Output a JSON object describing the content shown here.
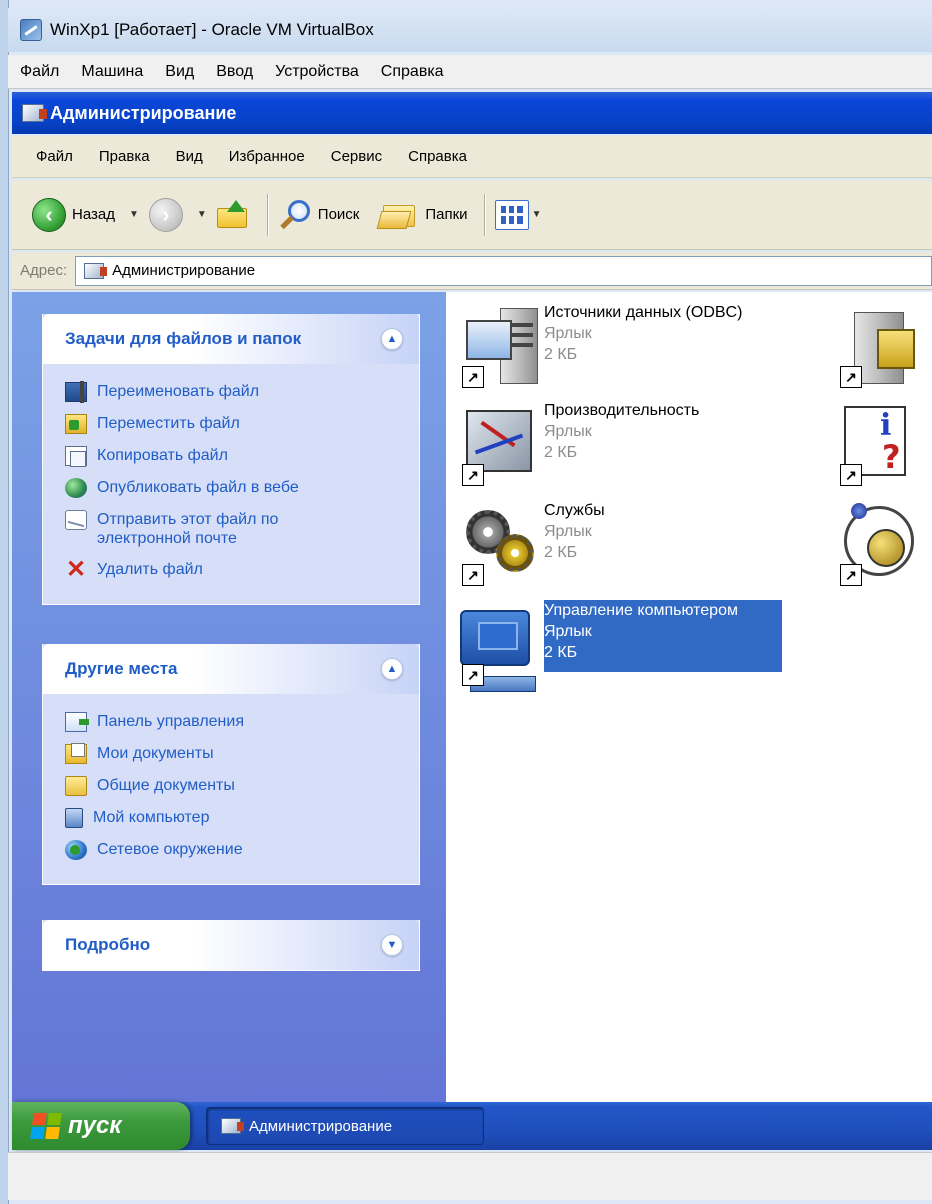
{
  "vbox": {
    "title": "WinXp1 [Работает] - Oracle VM VirtualBox",
    "menu": [
      "Файл",
      "Машина",
      "Вид",
      "Ввод",
      "Устройства",
      "Справка"
    ]
  },
  "explorer": {
    "title": "Администрирование",
    "menu": [
      "Файл",
      "Правка",
      "Вид",
      "Избранное",
      "Сервис",
      "Справка"
    ],
    "toolbar": {
      "back_label": "Назад",
      "search_label": "Поиск",
      "folders_label": "Папки"
    },
    "address": {
      "label": "Адрес:",
      "value": "Администрирование"
    }
  },
  "tasks_panel": {
    "title": "Задачи для файлов и папок",
    "items": [
      {
        "label": "Переименовать файл",
        "icon": "rename-icon"
      },
      {
        "label": "Переместить файл",
        "icon": "move-icon"
      },
      {
        "label": "Копировать файл",
        "icon": "copy-icon"
      },
      {
        "label": "Опубликовать файл в вебе",
        "icon": "publish-web-icon"
      },
      {
        "label": "Отправить этот файл по электронной почте",
        "icon": "email-icon"
      },
      {
        "label": "Удалить файл",
        "icon": "delete-icon"
      }
    ]
  },
  "places_panel": {
    "title": "Другие места",
    "items": [
      {
        "label": "Панель управления",
        "icon": "control-panel-icon"
      },
      {
        "label": "Мои документы",
        "icon": "my-documents-icon"
      },
      {
        "label": "Общие документы",
        "icon": "shared-documents-icon"
      },
      {
        "label": "Мой компьютер",
        "icon": "my-computer-icon"
      },
      {
        "label": "Сетевое окружение",
        "icon": "network-places-icon"
      }
    ]
  },
  "details_panel": {
    "title": "Подробно"
  },
  "files": [
    {
      "name": "Источники данных (ODBC)",
      "type": "Ярлык",
      "size": "2 КБ"
    },
    {
      "name": "Производительность",
      "type": "Ярлык",
      "size": "2 КБ"
    },
    {
      "name": "Службы",
      "type": "Ярлык",
      "size": "2 КБ"
    },
    {
      "name": "Управление компьютером",
      "type": "Ярлык",
      "size": "2 КБ",
      "selected": true
    }
  ],
  "taskbar": {
    "start_label": "пуск",
    "task_label": "Администрирование"
  },
  "colors": {
    "xp_blue": "#0842c8",
    "selection": "#316ac5",
    "link_blue": "#215dc6",
    "start_green": "#3c9a3c"
  }
}
